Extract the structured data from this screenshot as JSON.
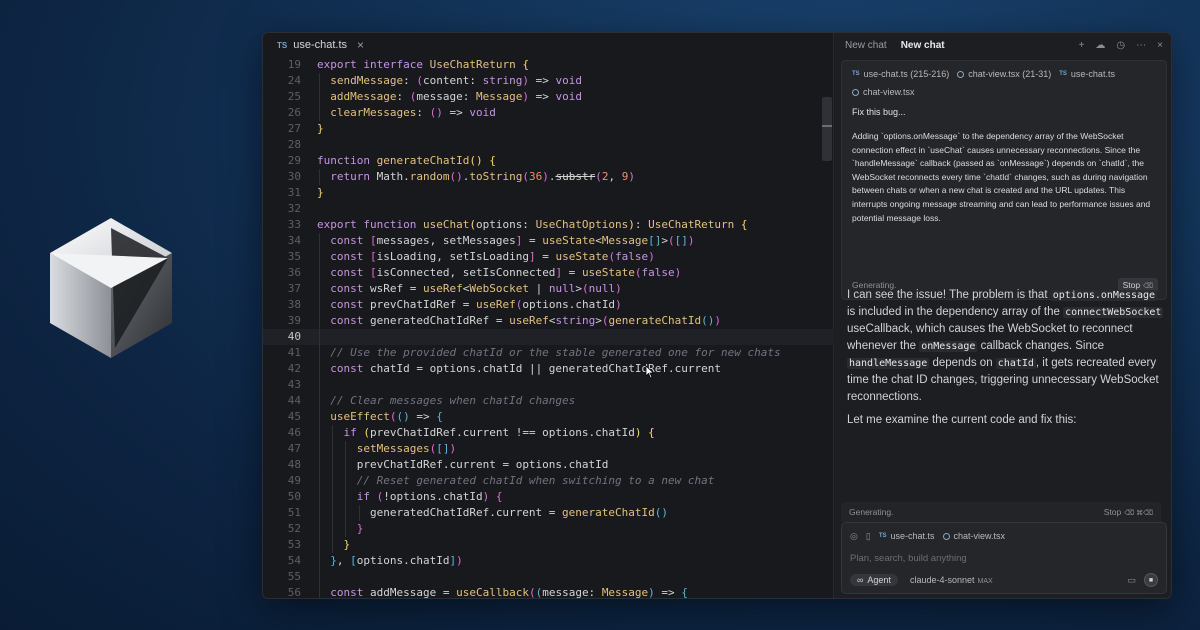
{
  "editor": {
    "tab": {
      "badge": "TS",
      "filename": "use-chat.ts",
      "close_glyph": "×"
    },
    "lines": [
      {
        "n": "19",
        "indent": 0,
        "tokens": [
          [
            "kw",
            "export interface "
          ],
          [
            "ty",
            "UseChatReturn"
          ],
          [
            "pu",
            " "
          ],
          [
            "br1",
            "{"
          ]
        ]
      },
      {
        "n": "24",
        "indent": 1,
        "tokens": [
          [
            "fn",
            "sendMessage"
          ],
          [
            "pu",
            ": "
          ],
          [
            "br2",
            "("
          ],
          [
            "pu",
            "content: "
          ],
          [
            "kw",
            "string"
          ],
          [
            "br2",
            ")"
          ],
          [
            "pu",
            " => "
          ],
          [
            "kw",
            "void"
          ]
        ]
      },
      {
        "n": "25",
        "indent": 1,
        "tokens": [
          [
            "fn",
            "addMessage"
          ],
          [
            "pu",
            ": "
          ],
          [
            "br2",
            "("
          ],
          [
            "pu",
            "message: "
          ],
          [
            "ty",
            "Message"
          ],
          [
            "br2",
            ")"
          ],
          [
            "pu",
            " => "
          ],
          [
            "kw",
            "void"
          ]
        ]
      },
      {
        "n": "26",
        "indent": 1,
        "tokens": [
          [
            "fn",
            "clearMessages"
          ],
          [
            "pu",
            ": "
          ],
          [
            "br2",
            "()"
          ],
          [
            "pu",
            " => "
          ],
          [
            "kw",
            "void"
          ]
        ]
      },
      {
        "n": "27",
        "indent": 0,
        "tokens": [
          [
            "br1",
            "}"
          ]
        ]
      },
      {
        "n": "28",
        "indent": 0,
        "tokens": []
      },
      {
        "n": "29",
        "indent": 0,
        "tokens": [
          [
            "kw",
            "function "
          ],
          [
            "fn",
            "generateChatId"
          ],
          [
            "br1",
            "()"
          ],
          [
            "pu",
            " "
          ],
          [
            "br1",
            "{"
          ]
        ]
      },
      {
        "n": "30",
        "indent": 1,
        "tokens": [
          [
            "kw",
            "return "
          ],
          [
            "pu",
            "Math."
          ],
          [
            "fn",
            "random"
          ],
          [
            "br2",
            "()"
          ],
          [
            "pu",
            "."
          ],
          [
            "fn",
            "toString"
          ],
          [
            "br2",
            "("
          ],
          [
            "num",
            "36"
          ],
          [
            "br2",
            ")"
          ],
          [
            "pu",
            "."
          ],
          [
            "strike",
            "substr"
          ],
          [
            "br2",
            "("
          ],
          [
            "num",
            "2"
          ],
          [
            "pu",
            ", "
          ],
          [
            "num",
            "9"
          ],
          [
            "br2",
            ")"
          ]
        ]
      },
      {
        "n": "31",
        "indent": 0,
        "tokens": [
          [
            "br1",
            "}"
          ]
        ]
      },
      {
        "n": "32",
        "indent": 0,
        "tokens": []
      },
      {
        "n": "33",
        "indent": 0,
        "tokens": [
          [
            "kw",
            "export function "
          ],
          [
            "fn",
            "useChat"
          ],
          [
            "br1",
            "("
          ],
          [
            "pu",
            "options: "
          ],
          [
            "ty",
            "UseChatOptions"
          ],
          [
            "br1",
            ")"
          ],
          [
            "pu",
            ": "
          ],
          [
            "ty",
            "UseChatReturn"
          ],
          [
            "pu",
            " "
          ],
          [
            "br1",
            "{"
          ]
        ]
      },
      {
        "n": "34",
        "indent": 1,
        "tokens": [
          [
            "kw",
            "const "
          ],
          [
            "br2",
            "["
          ],
          [
            "pu",
            "messages, setMessages"
          ],
          [
            "br2",
            "]"
          ],
          [
            "pu",
            " = "
          ],
          [
            "fn",
            "useState"
          ],
          [
            "pu",
            "<"
          ],
          [
            "ty",
            "Message"
          ],
          [
            "br3",
            "[]"
          ],
          [
            "pu",
            ">"
          ],
          [
            "br2",
            "("
          ],
          [
            "br3",
            "[]"
          ],
          [
            "br2",
            ")"
          ]
        ]
      },
      {
        "n": "35",
        "indent": 1,
        "tokens": [
          [
            "kw",
            "const "
          ],
          [
            "br2",
            "["
          ],
          [
            "pu",
            "isLoading, setIsLoading"
          ],
          [
            "br2",
            "]"
          ],
          [
            "pu",
            " = "
          ],
          [
            "fn",
            "useState"
          ],
          [
            "br2",
            "("
          ],
          [
            "kw",
            "false"
          ],
          [
            "br2",
            ")"
          ]
        ]
      },
      {
        "n": "36",
        "indent": 1,
        "tokens": [
          [
            "kw",
            "const "
          ],
          [
            "br2",
            "["
          ],
          [
            "pu",
            "isConnected, setIsConnected"
          ],
          [
            "br2",
            "]"
          ],
          [
            "pu",
            " = "
          ],
          [
            "fn",
            "useState"
          ],
          [
            "br2",
            "("
          ],
          [
            "kw",
            "false"
          ],
          [
            "br2",
            ")"
          ]
        ]
      },
      {
        "n": "37",
        "indent": 1,
        "tokens": [
          [
            "kw",
            "const "
          ],
          [
            "pu",
            "wsRef = "
          ],
          [
            "fn",
            "useRef"
          ],
          [
            "pu",
            "<"
          ],
          [
            "ty",
            "WebSocket"
          ],
          [
            "pu",
            " | "
          ],
          [
            "kw",
            "null"
          ],
          [
            "pu",
            ">"
          ],
          [
            "br2",
            "("
          ],
          [
            "kw",
            "null"
          ],
          [
            "br2",
            ")"
          ]
        ]
      },
      {
        "n": "38",
        "indent": 1,
        "tokens": [
          [
            "kw",
            "const "
          ],
          [
            "pu",
            "prevChatIdRef = "
          ],
          [
            "fn",
            "useRef"
          ],
          [
            "br2",
            "("
          ],
          [
            "pu",
            "options.chatId"
          ],
          [
            "br2",
            ")"
          ]
        ]
      },
      {
        "n": "39",
        "indent": 1,
        "tokens": [
          [
            "kw",
            "const "
          ],
          [
            "pu",
            "generatedChatIdRef = "
          ],
          [
            "fn",
            "useRef"
          ],
          [
            "pu",
            "<"
          ],
          [
            "kw",
            "string"
          ],
          [
            "pu",
            ">"
          ],
          [
            "br2",
            "("
          ],
          [
            "fn",
            "generateChatId"
          ],
          [
            "br3",
            "()"
          ],
          [
            "br2",
            ")"
          ]
        ]
      },
      {
        "n": "40",
        "indent": 1,
        "tokens": [],
        "active": true
      },
      {
        "n": "41",
        "indent": 1,
        "tokens": [
          [
            "cm",
            "// Use the provided chatId or the stable generated one for new chats"
          ]
        ]
      },
      {
        "n": "42",
        "indent": 1,
        "tokens": [
          [
            "kw",
            "const "
          ],
          [
            "pu",
            "chatId = options.chatId || generatedChatIdRef.current"
          ]
        ]
      },
      {
        "n": "43",
        "indent": 1,
        "tokens": []
      },
      {
        "n": "44",
        "indent": 1,
        "tokens": [
          [
            "cm",
            "// Clear messages when chatId changes"
          ]
        ]
      },
      {
        "n": "45",
        "indent": 1,
        "tokens": [
          [
            "fn",
            "useEffect"
          ],
          [
            "br2",
            "("
          ],
          [
            "br3",
            "()"
          ],
          [
            "pu",
            " => "
          ],
          [
            "br3",
            "{"
          ]
        ]
      },
      {
        "n": "46",
        "indent": 2,
        "tokens": [
          [
            "kw",
            "if "
          ],
          [
            "br1",
            "("
          ],
          [
            "pu",
            "prevChatIdRef.current !== options.chatId"
          ],
          [
            "br1",
            ")"
          ],
          [
            "pu",
            " "
          ],
          [
            "br1",
            "{"
          ]
        ]
      },
      {
        "n": "47",
        "indent": 3,
        "tokens": [
          [
            "fn",
            "setMessages"
          ],
          [
            "br2",
            "("
          ],
          [
            "br3",
            "[]"
          ],
          [
            "br2",
            ")"
          ]
        ]
      },
      {
        "n": "48",
        "indent": 3,
        "tokens": [
          [
            "pu",
            "prevChatIdRef.current = options.chatId"
          ]
        ]
      },
      {
        "n": "49",
        "indent": 3,
        "tokens": [
          [
            "cm",
            "// Reset generated chatId when switching to a new chat"
          ]
        ]
      },
      {
        "n": "50",
        "indent": 3,
        "tokens": [
          [
            "kw",
            "if "
          ],
          [
            "br2",
            "("
          ],
          [
            "pu",
            "!options.chatId"
          ],
          [
            "br2",
            ")"
          ],
          [
            "pu",
            " "
          ],
          [
            "br2",
            "{"
          ]
        ]
      },
      {
        "n": "51",
        "indent": 4,
        "tokens": [
          [
            "pu",
            "generatedChatIdRef.current = "
          ],
          [
            "fn",
            "generateChatId"
          ],
          [
            "br3",
            "()"
          ]
        ]
      },
      {
        "n": "52",
        "indent": 3,
        "tokens": [
          [
            "br2",
            "}"
          ]
        ]
      },
      {
        "n": "53",
        "indent": 2,
        "tokens": [
          [
            "br1",
            "}"
          ]
        ]
      },
      {
        "n": "54",
        "indent": 1,
        "tokens": [
          [
            "br3",
            "}"
          ],
          [
            "pu",
            ", "
          ],
          [
            "br3",
            "["
          ],
          [
            "pu",
            "options.chatId"
          ],
          [
            "br3",
            "]"
          ],
          [
            "br2",
            ")"
          ]
        ]
      },
      {
        "n": "55",
        "indent": 1,
        "tokens": []
      },
      {
        "n": "56",
        "indent": 1,
        "tokens": [
          [
            "kw",
            "const "
          ],
          [
            "pu",
            "addMessage = "
          ],
          [
            "fn",
            "useCallback"
          ],
          [
            "br2",
            "("
          ],
          [
            "br3",
            "("
          ],
          [
            "pu",
            "message: "
          ],
          [
            "ty",
            "Message"
          ],
          [
            "br3",
            ")"
          ],
          [
            "pu",
            " => "
          ],
          [
            "br3",
            "{"
          ]
        ]
      }
    ]
  },
  "chat": {
    "tabs": [
      "New chat",
      "New chat"
    ],
    "header_icons": [
      "plus-icon",
      "cloud-icon",
      "history-icon",
      "more-icon",
      "close-icon"
    ],
    "context_chips": [
      {
        "kind": "ts",
        "label": "use-chat.ts (215-216)"
      },
      {
        "kind": "react",
        "label": "chat-view.tsx (21-31)"
      },
      {
        "kind": "ts",
        "label": "use-chat.ts"
      },
      {
        "kind": "react",
        "label": "chat-view.tsx"
      }
    ],
    "user_message_title": "Fix this bug...",
    "user_message_body": "Adding `options.onMessage` to the dependency array of the WebSocket connection effect in `useChat` causes unnecessary reconnections. Since the `handleMessage` callback (passed as `onMessage`) depends on `chatId`, the WebSocket reconnects every time `chatId` changes, such as during navigation between chats or when a new chat is created and the URL updates. This interrupts ongoing message streaming and can lead to performance issues and potential message loss.",
    "card_status": "Generating.",
    "card_stop": "Stop",
    "card_stop_key": "⌫",
    "response": {
      "p1_a": "I can see the issue! The problem is that ",
      "p1_code1": "options.onMessage",
      "p1_b": " is included in the dependency array of the ",
      "p1_code2": "connectWebSocket",
      "p1_c": " useCallback, which causes the WebSocket to reconnect whenever the ",
      "p1_code3": "onMessage",
      "p1_d": " callback changes. Since ",
      "p1_code4": "handleMessage",
      "p1_e": " depends on ",
      "p1_code5": "chatId",
      "p1_f": ", it gets recreated every time the chat ID changes, triggering unnecessary WebSocket reconnections.",
      "p2": "Let me examine the current code and fix this:"
    },
    "gen_status": "Generating.",
    "gen_stop": "Stop",
    "gen_stop_key": "⌫ ⌘⌫",
    "input": {
      "chips": [
        {
          "kind": "ts",
          "label": "use-chat.ts"
        },
        {
          "kind": "react",
          "label": "chat-view.tsx"
        }
      ],
      "placeholder": "Plan, search, build anything",
      "mode": "Agent",
      "model": "claude-4-sonnet",
      "model_tag": "MAX"
    }
  }
}
